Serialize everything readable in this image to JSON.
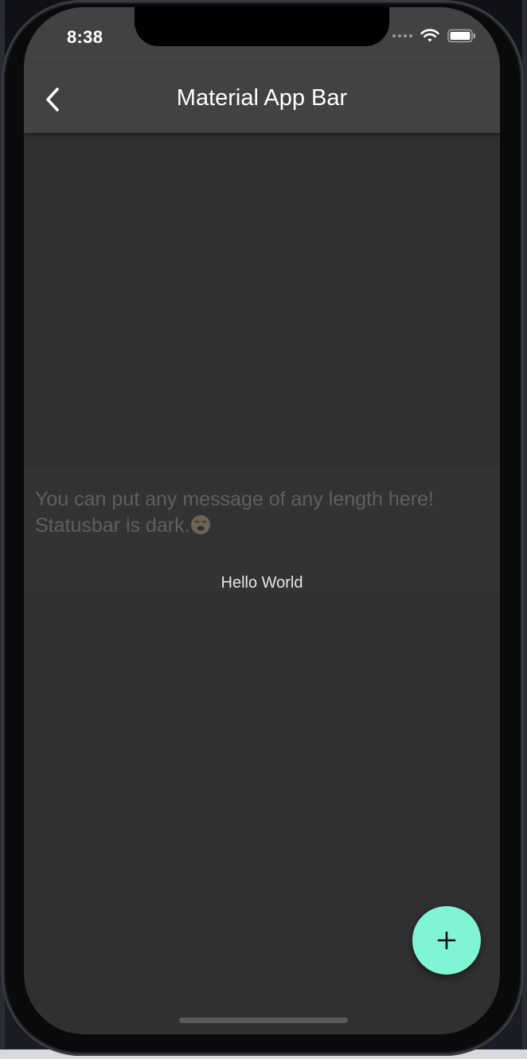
{
  "status_bar": {
    "time": "8:38",
    "icons": [
      "signal-icon",
      "wifi-icon",
      "battery-icon"
    ]
  },
  "app_bar": {
    "title": "Material App Bar",
    "back_icon": "chevron-left-icon",
    "background": "#424242"
  },
  "message": {
    "line1": "You can put any message of any length here!",
    "line2": "Statusbar is dark.",
    "emoji": "crying-face-emoji"
  },
  "hello_text": "Hello World",
  "fab": {
    "icon": "plus-icon",
    "color": "#7ff5d6"
  },
  "colors": {
    "screen_background": "#303030",
    "message_text": "#5f5f5f"
  }
}
